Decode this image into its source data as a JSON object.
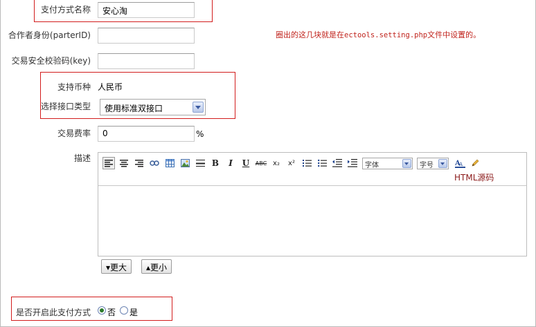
{
  "form": {
    "pay_name_label": "支付方式名称",
    "pay_name_value": "安心淘",
    "partner_label": "合作者身份(parterID)",
    "partner_value": "",
    "key_label": "交易安全校验码(key)",
    "key_value": "",
    "currency_label": "支持币种",
    "currency_value": "人民币",
    "interface_label": "选择接口类型",
    "interface_value": "使用标准双接口",
    "fee_label": "交易费率",
    "fee_value": "0",
    "fee_unit": "%",
    "desc_label": "描述",
    "enable_label": "是否开启此支付方式",
    "enable_options": [
      "否",
      "是"
    ],
    "enable_selected": "否"
  },
  "note": {
    "prefix": "圈出的这几块就是在",
    "file": "ectools.setting.php",
    "suffix": "文件中设置的。"
  },
  "editor": {
    "font_select": "字体",
    "size_select": "字号",
    "html_source": "HTML源码",
    "bold": "B",
    "italic": "I",
    "underline": "U",
    "strike": "ABC",
    "subscript": "x₂",
    "superscript": "x²",
    "grow_button": "▾更大",
    "shrink_button": "▴更小"
  },
  "colors": {
    "highlight_border": "#d21c1c",
    "note_text": "#c0231c"
  }
}
